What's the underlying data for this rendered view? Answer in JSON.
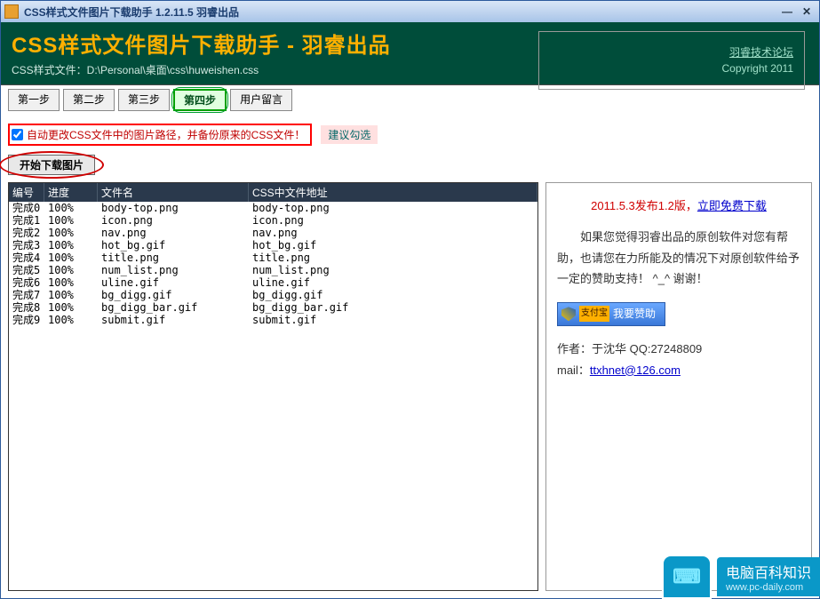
{
  "window": {
    "title": "CSS样式文件图片下载助手  1.2.11.5   羽睿出品"
  },
  "banner": {
    "heading": "CSS样式文件图片下载助手 - 羽睿出品",
    "path_label": "CSS样式文件：D:\\Personal\\桌面\\css\\huweishen.css",
    "link": "羽睿技术论坛",
    "copyright": "Copyright 2011"
  },
  "tabs": [
    "第一步",
    "第二步",
    "第三步",
    "第四步",
    "用户留言"
  ],
  "active_tab_index": 3,
  "option": {
    "checkbox_label": "自动更改CSS文件中的图片路径，并备份原来的CSS文件！",
    "checked": true,
    "hint": "建议勾选"
  },
  "start_button": "开始下载图片",
  "grid": {
    "headers": {
      "id": "编号",
      "progress": "进度",
      "filename": "文件名",
      "url": "CSS中文件地址"
    },
    "rows": [
      {
        "id": "完成0",
        "progress": "100%",
        "filename": "body-top.png",
        "url": "body-top.png"
      },
      {
        "id": "完成1",
        "progress": "100%",
        "filename": "icon.png",
        "url": "icon.png"
      },
      {
        "id": "完成2",
        "progress": "100%",
        "filename": "nav.png",
        "url": "nav.png"
      },
      {
        "id": "完成3",
        "progress": "100%",
        "filename": "hot_bg.gif",
        "url": "hot_bg.gif"
      },
      {
        "id": "完成4",
        "progress": "100%",
        "filename": "title.png",
        "url": "title.png"
      },
      {
        "id": "完成5",
        "progress": "100%",
        "filename": "num_list.png",
        "url": "num_list.png"
      },
      {
        "id": "完成6",
        "progress": "100%",
        "filename": "uline.gif",
        "url": "uline.gif"
      },
      {
        "id": "完成7",
        "progress": "100%",
        "filename": "bg_digg.gif",
        "url": "bg_digg.gif"
      },
      {
        "id": "完成8",
        "progress": "100%",
        "filename": "bg_digg_bar.gif",
        "url": "bg_digg_bar.gif"
      },
      {
        "id": "完成9",
        "progress": "100%",
        "filename": "submit.gif",
        "url": "submit.gif"
      }
    ]
  },
  "promo": {
    "release_prefix": "2011.5.3发布1.2版，",
    "release_link": "立即免费下载",
    "body": "如果您觉得羽睿出品的原创软件对您有帮助，也请您在力所能及的情况下对原创软件给予一定的赞助支持！ ^_^ 谢谢！",
    "donate_badge": "支付宝",
    "donate_label": "我要赞助",
    "author_line": "作者：于沈华  QQ:27248809",
    "mail_label": "mail：",
    "mail": "ttxhnet@126.com"
  },
  "watermark": {
    "brand": "电脑百科知识",
    "url": "www.pc-daily.com"
  }
}
